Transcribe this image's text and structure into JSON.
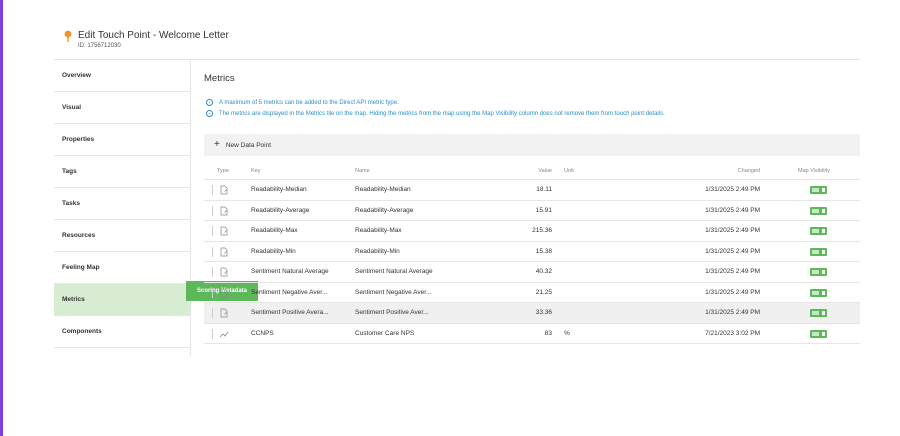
{
  "header": {
    "title": "Edit Touch Point - Welcome Letter",
    "id_label": "ID: 1756712030"
  },
  "sidebar": {
    "items": [
      {
        "label": "Overview",
        "active": false
      },
      {
        "label": "Visual",
        "active": false
      },
      {
        "label": "Properties",
        "active": false
      },
      {
        "label": "Tags",
        "active": false
      },
      {
        "label": "Tasks",
        "active": false
      },
      {
        "label": "Resources",
        "active": false
      },
      {
        "label": "Feeling Map",
        "active": false
      },
      {
        "label": "Metrics",
        "active": true
      },
      {
        "label": "Components",
        "active": false
      }
    ]
  },
  "tooltip": {
    "text": "Scoring Metadata"
  },
  "main": {
    "title": "Metrics",
    "info": [
      "A maximum of 5 metrics can be added to the Direct API metric type.",
      "The metrics are displayed in the Metrics tile on the map. Hiding the metrics from the map using the Map Visibility column does not remove them from touch point details."
    ],
    "new_button": "New Data Point"
  },
  "table": {
    "headers": {
      "type": "Type",
      "key": "Key",
      "name": "Name",
      "value": "Value",
      "unit": "Unit",
      "changed": "Changed",
      "map": "Map Visibility"
    },
    "rows": [
      {
        "icon": "document-edit-icon",
        "key": "Readability-Median",
        "name": "Readability-Median",
        "value": "18.11",
        "unit": "",
        "changed": "1/31/2025 2:49 PM",
        "visible": true,
        "highlighted": false
      },
      {
        "icon": "document-edit-icon",
        "key": "Readability-Average",
        "name": "Readability-Average",
        "value": "15.91",
        "unit": "",
        "changed": "1/31/2025 2:49 PM",
        "visible": true,
        "highlighted": false
      },
      {
        "icon": "document-edit-icon",
        "key": "Readability-Max",
        "name": "Readability-Max",
        "value": "215.36",
        "unit": "",
        "changed": "1/31/2025 2:49 PM",
        "visible": true,
        "highlighted": false
      },
      {
        "icon": "document-edit-icon",
        "key": "Readability-Min",
        "name": "Readability-Min",
        "value": "15.38",
        "unit": "",
        "changed": "1/31/2025 2:49 PM",
        "visible": true,
        "highlighted": false
      },
      {
        "icon": "document-edit-icon",
        "key": "Sentiment Natural Average",
        "name": "Sentiment Natural Average",
        "value": "40.32",
        "unit": "",
        "changed": "1/31/2025 2:49 PM",
        "visible": true,
        "highlighted": false
      },
      {
        "icon": "document-edit-icon",
        "key": "Sentiment Negative Aver...",
        "name": "Sentiment Negative Aver...",
        "value": "21.25",
        "unit": "",
        "changed": "1/31/2025 2:49 PM",
        "visible": true,
        "highlighted": false
      },
      {
        "icon": "document-edit-icon",
        "key": "Sentiment Positive Avera...",
        "name": "Sentiment Positive Aver...",
        "value": "33.36",
        "unit": "",
        "changed": "1/31/2025 2:49 PM",
        "visible": true,
        "highlighted": true
      },
      {
        "icon": "trend-line-icon",
        "key": "CCNPS",
        "name": "Customer Care NPS",
        "value": "83",
        "unit": "%",
        "changed": "7/21/2023 3:02 PM",
        "visible": true,
        "highlighted": false
      }
    ]
  },
  "colors": {
    "accent_green": "#5db85a",
    "info_blue": "#2a8fc9",
    "active_nav": "#d7ecd0",
    "pin_orange": "#f0932b",
    "edge_purple": "#7b3fe4"
  }
}
